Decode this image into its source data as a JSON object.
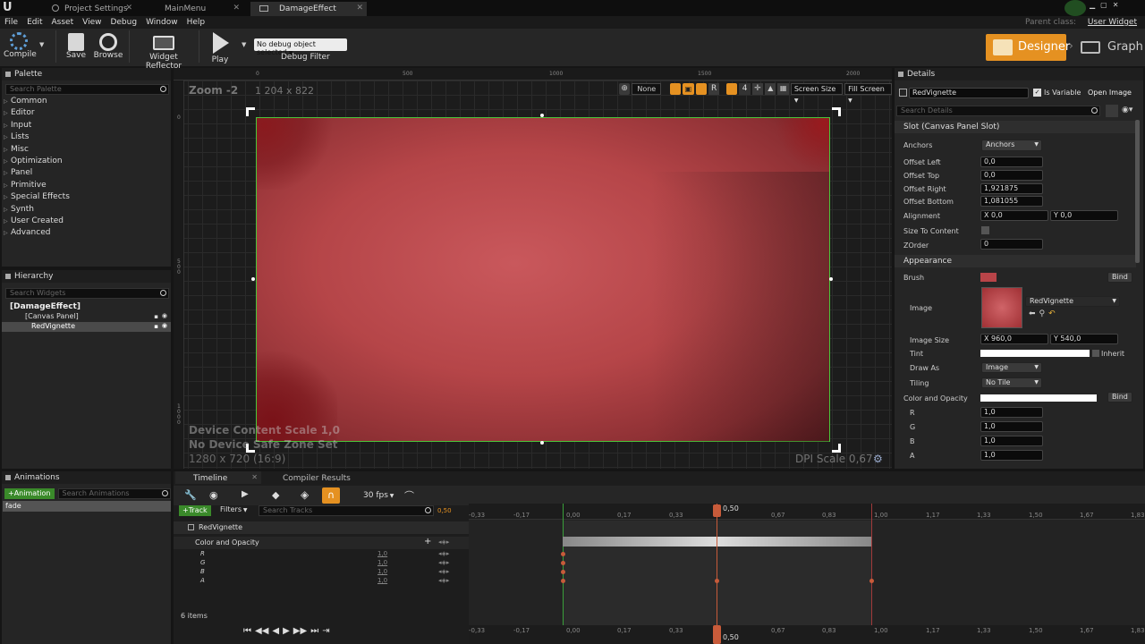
{
  "tabs": [
    {
      "label": "Project Settings"
    },
    {
      "label": "MainMenu"
    },
    {
      "label": "DamageEffect"
    }
  ],
  "parent_class": {
    "label": "Parent class:",
    "value": "User Widget"
  },
  "menu": [
    "File",
    "Edit",
    "Asset",
    "View",
    "Debug",
    "Window",
    "Help"
  ],
  "toolbar": {
    "compile": "Compile",
    "save": "Save",
    "browse": "Browse",
    "reflector": "Widget Reflector",
    "play": "Play",
    "debug_select": "No debug object selected",
    "debug_filter": "Debug Filter",
    "designer": "Designer",
    "graph": "Graph"
  },
  "palette": {
    "title": "Palette",
    "search_placeholder": "Search Palette",
    "items": [
      "Common",
      "Editor",
      "Input",
      "Lists",
      "Misc",
      "Optimization",
      "Panel",
      "Primitive",
      "Special Effects",
      "Synth",
      "User Created",
      "Advanced"
    ]
  },
  "hierarchy": {
    "title": "Hierarchy",
    "search_placeholder": "Search Widgets",
    "root": "[DamageEffect]",
    "canvas": "[Canvas Panel]",
    "child": "RedVignette"
  },
  "viewport": {
    "zoom": "Zoom -2",
    "size": "1 204 x 822",
    "ruler_x": [
      "0",
      "500",
      "1000",
      "1500",
      "2000"
    ],
    "ruler_y": [
      "0",
      "500",
      "1000"
    ],
    "none_label": "None",
    "r_label": "R",
    "grid_num": "4",
    "screen_size": "Screen Size",
    "fill_screen": "Fill Screen",
    "device_scale": "Device Content Scale 1,0",
    "safe_zone": "No Device Safe Zone Set",
    "resolution": "1280 x 720 (16:9)",
    "dpi": "DPI Scale 0,67"
  },
  "details": {
    "title": "Details",
    "name": "RedVignette",
    "is_variable": "Is Variable",
    "open_image": "Open Image",
    "search_placeholder": "Search Details",
    "slot_section": "Slot (Canvas Panel Slot)",
    "anchors_label": "Anchors",
    "anchors_value": "Anchors",
    "offset_left": {
      "label": "Offset Left",
      "value": "0,0"
    },
    "offset_top": {
      "label": "Offset Top",
      "value": "0,0"
    },
    "offset_right": {
      "label": "Offset Right",
      "value": "1,921875"
    },
    "offset_bottom": {
      "label": "Offset Bottom",
      "value": "1,081055"
    },
    "alignment": {
      "label": "Alignment",
      "x": "X 0,0",
      "y": "Y 0,0"
    },
    "size_to_content": "Size To Content",
    "zorder": {
      "label": "ZOrder",
      "value": "0"
    },
    "appearance_section": "Appearance",
    "brush": "Brush",
    "bind": "Bind",
    "image_label": "Image",
    "image_asset": "RedVignette",
    "image_size": {
      "label": "Image Size",
      "x": "X 960,0",
      "y": "Y 540,0"
    },
    "tint": "Tint",
    "inherit": "Inherit",
    "draw_as": {
      "label": "Draw As",
      "value": "Image"
    },
    "tiling": {
      "label": "Tiling",
      "value": "No Tile"
    },
    "color_opacity": "Color and Opacity",
    "r": {
      "label": "R",
      "value": "1,0"
    },
    "g": {
      "label": "G",
      "value": "1,0"
    },
    "b": {
      "label": "B",
      "value": "1,0"
    },
    "a": {
      "label": "A",
      "value": "1,0"
    }
  },
  "animations": {
    "title": "Animations",
    "add": "+Animation",
    "search_placeholder": "Search Animations",
    "items": [
      "fade"
    ]
  },
  "timeline": {
    "tab_timeline": "Timeline",
    "tab_compiler": "Compiler Results",
    "fps": "30 fps",
    "track_btn": "+Track",
    "filters": "Filters",
    "search_placeholder": "Search Tracks",
    "current_time": "0,50",
    "track": "RedVignette",
    "property": "Color and Opacity",
    "channels": [
      {
        "name": "R",
        "value": "1,0"
      },
      {
        "name": "G",
        "value": "1,0"
      },
      {
        "name": "B",
        "value": "1,0"
      },
      {
        "name": "A",
        "value": "1,0"
      }
    ],
    "items_count": "6 items",
    "ticks": [
      "-0,33",
      "-0,17",
      "0,00",
      "0,17",
      "0,33",
      "0,50",
      "0,67",
      "0,83",
      "1,00",
      "1,17",
      "1,33",
      "1,50",
      "1,67",
      "1,83"
    ]
  },
  "colors": {
    "accent_orange": "#f0a020",
    "selection_green": "#4cc43a",
    "key_red": "#c85b3a",
    "vignette_red": "#c0454a"
  }
}
